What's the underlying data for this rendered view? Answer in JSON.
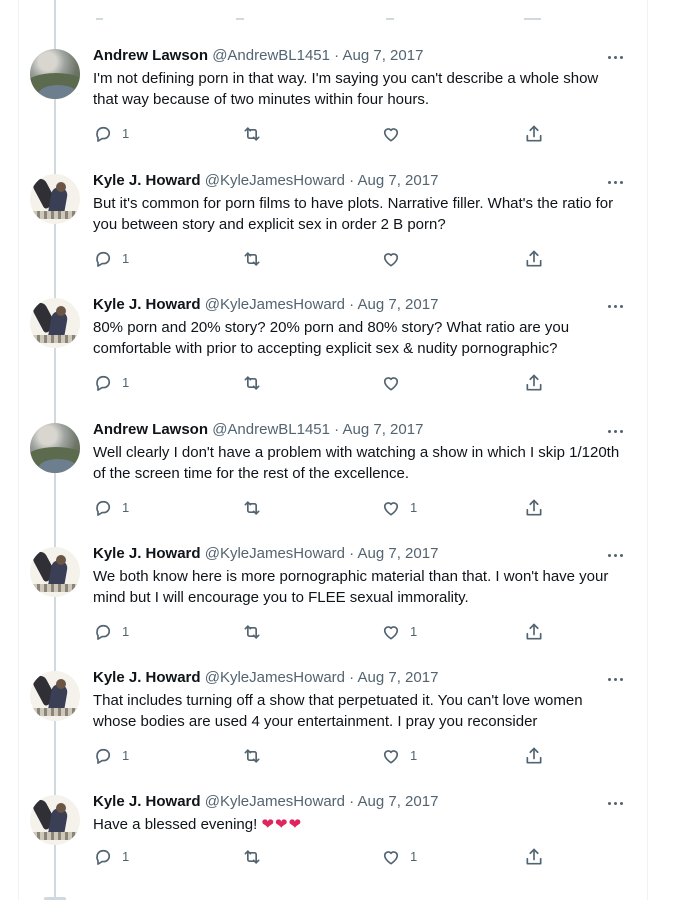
{
  "colors": {
    "link_gray": "#536471",
    "heart": "#e0245e",
    "thread": "#cfd9de"
  },
  "icons": {
    "reply": "reply-icon",
    "retweet": "retweet-icon",
    "like": "like-icon",
    "share": "share-icon",
    "more": "more-icon"
  },
  "tweets": [
    {
      "name": "Andrew Lawson",
      "handle": "@AndrewBL1451",
      "sep": "·",
      "date": "Aug 7, 2017",
      "text": "I'm not defining porn in that way.  I'm saying you can't describe a whole show that way because of two minutes within four hours.",
      "replies": "1",
      "likes": ""
    },
    {
      "name": "Kyle J. Howard",
      "handle": "@KyleJamesHoward",
      "sep": "·",
      "date": "Aug 7, 2017",
      "text": "But it's common for porn films to have plots. Narrative filler. What's the ratio for you between story and explicit sex in order 2 B porn?",
      "replies": "1",
      "likes": ""
    },
    {
      "name": "Kyle J. Howard",
      "handle": "@KyleJamesHoward",
      "sep": "·",
      "date": "Aug 7, 2017",
      "text": "80% porn and 20% story? 20% porn and 80% story? What ratio are you comfortable with prior to accepting explicit sex & nudity pornographic?",
      "replies": "1",
      "likes": ""
    },
    {
      "name": "Andrew Lawson",
      "handle": "@AndrewBL1451",
      "sep": "·",
      "date": "Aug 7, 2017",
      "text": "Well clearly I don't have a problem with watching a show in which I skip 1/120th of the screen time for the rest of the excellence.",
      "replies": "1",
      "likes": "1"
    },
    {
      "name": "Kyle J. Howard",
      "handle": "@KyleJamesHoward",
      "sep": "·",
      "date": "Aug 7, 2017",
      "text": "We both know here is more pornographic material than that. I won't have your mind but I will encourage you to FLEE sexual immorality.",
      "replies": "1",
      "likes": "1"
    },
    {
      "name": "Kyle J. Howard",
      "handle": "@KyleJamesHoward",
      "sep": "·",
      "date": "Aug 7, 2017",
      "text": "That includes turning off a show that perpetuated it. You can't love women whose bodies are used 4 your entertainment. I pray you reconsider",
      "replies": "1",
      "likes": "1"
    },
    {
      "name": "Kyle J. Howard",
      "handle": "@KyleJamesHoward",
      "sep": "·",
      "date": "Aug 7, 2017",
      "text": "Have a blessed evening! ",
      "emoji": "❤❤❤",
      "replies": "1",
      "likes": "1"
    }
  ]
}
